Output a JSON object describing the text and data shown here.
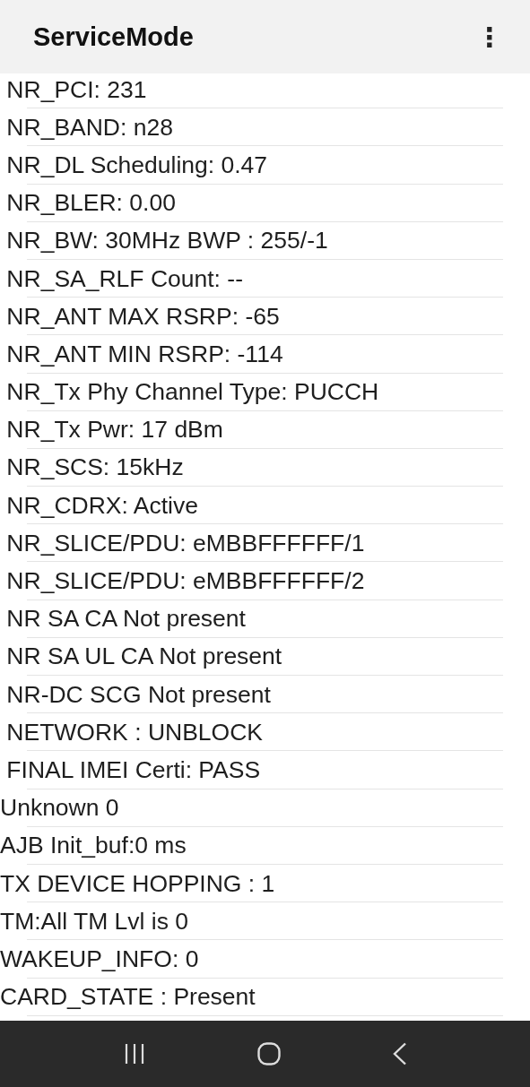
{
  "app_bar": {
    "title": "ServiceMode",
    "menu_icon": "⋮"
  },
  "lines": [
    " NR_PCI: 231",
    " NR_BAND: n28",
    " NR_DL Scheduling: 0.47",
    " NR_BLER: 0.00",
    " NR_BW: 30MHz BWP : 255/-1",
    " NR_SA_RLF Count: --",
    " NR_ANT MAX RSRP: -65",
    " NR_ANT MIN RSRP: -114",
    " NR_Tx Phy Channel Type: PUCCH",
    " NR_Tx Pwr: 17 dBm",
    " NR_SCS: 15kHz",
    " NR_CDRX: Active",
    " NR_SLICE/PDU: eMBBFFFFFF/1",
    " NR_SLICE/PDU: eMBBFFFFFF/2",
    " NR SA CA Not present",
    " NR SA UL CA Not present",
    " NR-DC SCG Not present",
    " NETWORK : UNBLOCK",
    " FINAL IMEI Certi: PASS",
    "Unknown 0",
    "AJB Init_buf:0 ms",
    "TX DEVICE HOPPING : 1",
    "TM:All TM Lvl is 0",
    "WAKEUP_INFO: 0",
    "CARD_STATE : Present"
  ]
}
